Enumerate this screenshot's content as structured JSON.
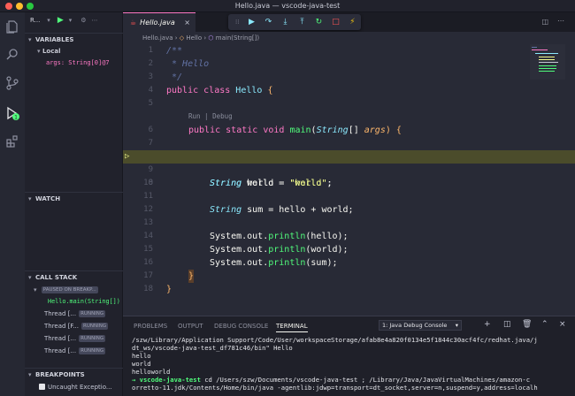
{
  "window": {
    "title": "Hello.java — vscode-java-test"
  },
  "sidebar": {
    "run_label": "R...",
    "variables_header": "VARIABLES",
    "local_label": "Local",
    "args_var": "args: String[0]@7",
    "watch_header": "WATCH",
    "callstack_header": "CALL STACK",
    "paused_badge": "PAUSED ON BREAKP...",
    "main_frame": "Hello.main(String[])",
    "threads": [
      {
        "name": "Thread [...",
        "status": "RUNNING"
      },
      {
        "name": "Thread [F...",
        "status": "RUNNING"
      },
      {
        "name": "Thread [...",
        "status": "RUNNING"
      },
      {
        "name": "Thread [...",
        "status": "RUNNING"
      }
    ],
    "breakpoints_header": "BREAKPOINTS",
    "uncaught_exceptions": "Uncaught Exceptio..."
  },
  "editor": {
    "tab_label": "Hello.java",
    "breadcrumb": {
      "file": "Hello.java",
      "class": "Hello",
      "method": "main(String[])"
    },
    "codelens": "Run | Debug",
    "lines": {
      "l1": "/**",
      "l2": " * Hello",
      "l3": " */",
      "l4a": "public",
      "l4b": "class",
      "l4c": "Hello",
      "l4d": "{",
      "l6a": "public",
      "l6b": "static",
      "l6c": "void",
      "l6d": "main",
      "l6e": "(",
      "l6f": "String",
      "l6g": "[]",
      "l6h": "args",
      "l6i": ") {",
      "l8a": "String",
      "l8b": "hello",
      "l8c": " = ",
      "l8d": "\"hello\"",
      "l8e": ";",
      "l10a": "String",
      "l10b": "world",
      "l10c": " = ",
      "l10d": "\"world\"",
      "l10e": ";",
      "l12a": "String",
      "l12b": "sum",
      "l12c": " = hello + world;",
      "l14": "System.out.",
      "l14f": "println",
      "l14r": "(hello);",
      "l15": "System.out.",
      "l15f": "println",
      "l15r": "(world);",
      "l16": "System.out.",
      "l16f": "println",
      "l16r": "(sum);",
      "l17": "}",
      "l18": "}"
    },
    "line_numbers": [
      "1",
      "2",
      "3",
      "4",
      "5",
      "6",
      "7",
      "8",
      "9",
      "10",
      "11",
      "12",
      "13",
      "14",
      "15",
      "16",
      "17",
      "18"
    ],
    "current_line": 8
  },
  "panel": {
    "tabs": [
      "PROBLEMS",
      "OUTPUT",
      "DEBUG CONSOLE",
      "TERMINAL"
    ],
    "active_tab": "TERMINAL",
    "terminal_select": "1: Java Debug Console",
    "terminal_lines": {
      "t1": "/szw/Library/Application Support/Code/User/workspaceStorage/afab8e4a820f0134e5f1844c30acf4fc/redhat.java/j",
      "t2": "dt_ws/vscode-java-test_df781c46/bin\" Hello",
      "t3": "hello",
      "t4": "world",
      "t5": "helloworld",
      "t6_prompt": "→ vscode-java-test",
      "t6_rest": " cd /Users/szw/Documents/vscode-java-test ; /Library/Java/JavaVirtualMachines/amazon-c",
      "t7": "orretto-11.jdk/Contents/Home/bin/java -agentlib:jdwp=transport=dt_socket,server=n,suspend=y,address=localh"
    }
  },
  "colors": {
    "accent": "#ff79c6",
    "editor_bg": "#282a36",
    "highlight": "#4b4c2b",
    "badge": "#50fa7b"
  }
}
